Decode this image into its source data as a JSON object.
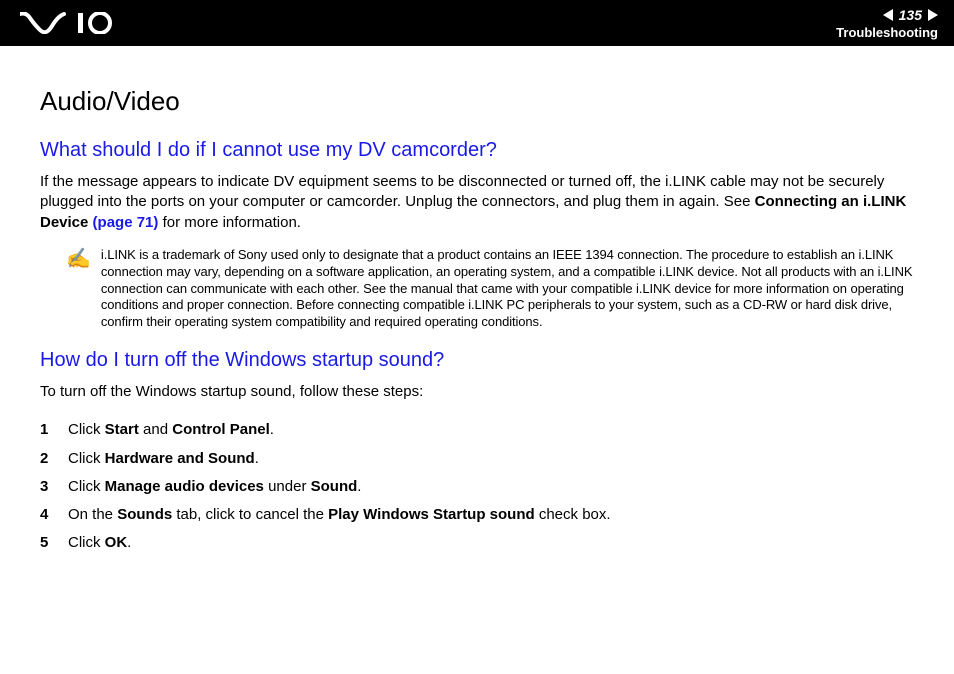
{
  "header": {
    "page_number": "135",
    "section": "Troubleshooting"
  },
  "title": "Audio/Video",
  "q1": {
    "heading": "What should I do if I cannot use my DV camcorder?",
    "para_pre": "If the message appears to indicate DV equipment seems to be disconnected or turned off, the i.LINK cable may not be securely plugged into the ports on your computer or camcorder. Unplug the connectors, and plug them in again. See ",
    "link_label": "Connecting an i.LINK Device",
    "link_page": " (page 71)",
    "para_post": " for more information.",
    "note": "i.LINK is a trademark of Sony used only to designate that a product contains an IEEE 1394 connection. The procedure to establish an i.LINK connection may vary, depending on a software application, an operating system, and a compatible i.LINK device. Not all products with an i.LINK connection can communicate with each other. See the manual that came with your compatible i.LINK device for more information on operating conditions and proper connection. Before connecting compatible i.LINK PC peripherals to your system, such as a CD-RW or hard disk drive, confirm their operating system compatibility and required operating conditions."
  },
  "q2": {
    "heading": "How do I turn off the Windows startup sound?",
    "intro": "To turn off the Windows startup sound, follow these steps:",
    "steps": {
      "s1_a": "Click ",
      "s1_b": "Start",
      "s1_c": " and ",
      "s1_d": "Control Panel",
      "s1_e": ".",
      "s2_a": "Click ",
      "s2_b": "Hardware and Sound",
      "s2_c": ".",
      "s3_a": "Click ",
      "s3_b": "Manage audio devices",
      "s3_c": " under ",
      "s3_d": "Sound",
      "s3_e": ".",
      "s4_a": "On the ",
      "s4_b": "Sounds",
      "s4_c": " tab, click to cancel the ",
      "s4_d": "Play Windows Startup sound",
      "s4_e": " check box.",
      "s5_a": "Click ",
      "s5_b": "OK",
      "s5_c": "."
    }
  }
}
